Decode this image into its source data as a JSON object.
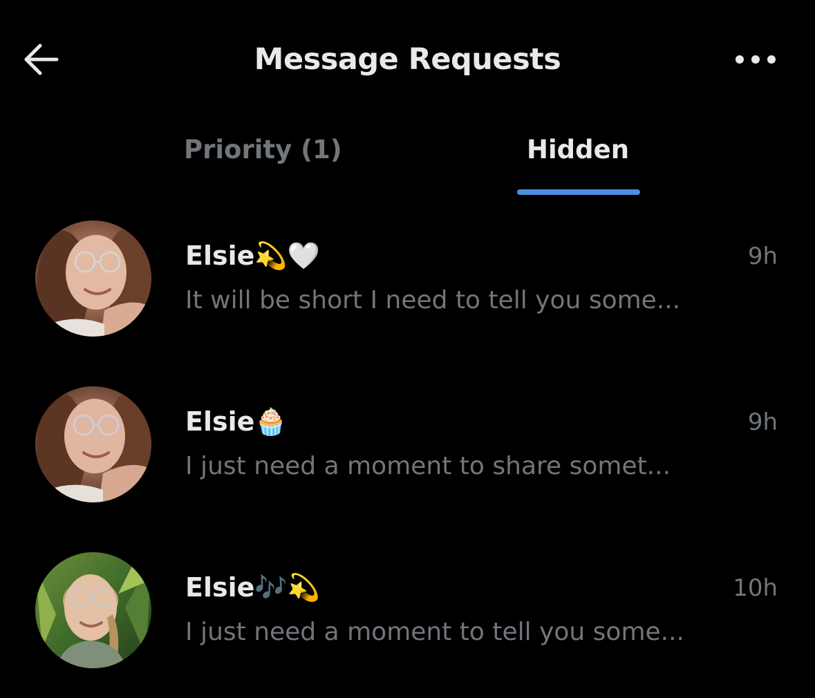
{
  "header": {
    "title": "Message Requests",
    "back_icon": "arrow-left-icon",
    "more_icon": "ellipsis-icon"
  },
  "tabs": [
    {
      "label": "Priority (1)",
      "active": false
    },
    {
      "label": "Hidden",
      "active": true
    }
  ],
  "colors": {
    "background": "#000000",
    "primary_text": "#e7e9ea",
    "secondary_text": "#71767b",
    "accent": "#4a90e2"
  },
  "conversations": [
    {
      "name": "Elsie💫🤍",
      "time": "9h",
      "preview": "It will be short I need to tell you some...",
      "avatar_icon": "profile-photo"
    },
    {
      "name": "Elsie🧁",
      "time": "9h",
      "preview": "I just need a moment to share somet...",
      "avatar_icon": "profile-photo"
    },
    {
      "name": "Elsie🎶💫",
      "time": "10h",
      "preview": "I just need a moment to tell you some...",
      "avatar_icon": "profile-photo"
    }
  ]
}
